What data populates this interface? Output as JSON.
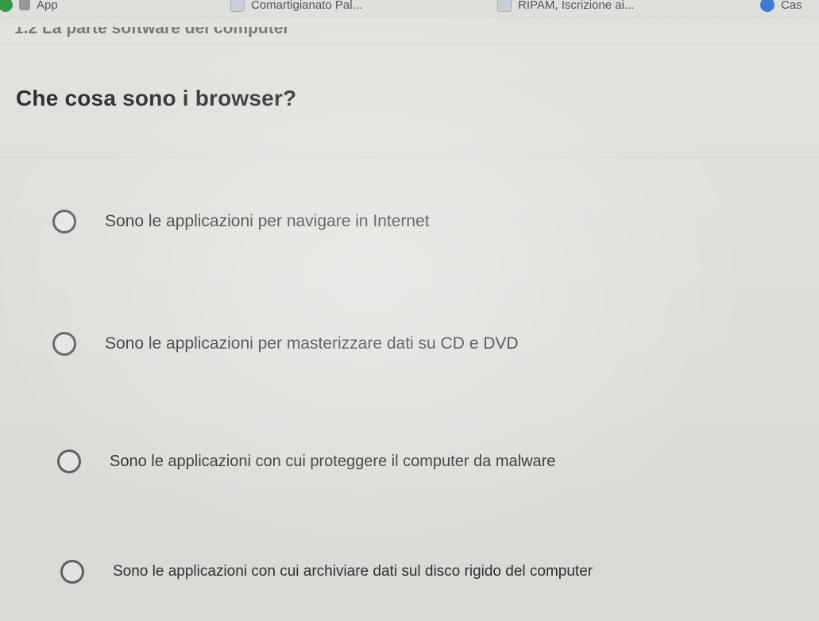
{
  "bookmarks": [
    {
      "label": "App",
      "icon": "app-grid-icon"
    },
    {
      "label": "Comartigianato Pal...",
      "icon": "page-icon"
    },
    {
      "label": "RIPAM, Iscrizione ai...",
      "icon": "document-icon"
    },
    {
      "label": "Cas",
      "icon": "blue-circle-icon"
    }
  ],
  "section": {
    "heading": "1.2 La parte software del computer"
  },
  "quiz": {
    "question": "Che cosa sono i browser?",
    "options": [
      {
        "label": "Sono le applicazioni per navigare in Internet"
      },
      {
        "label": "Sono le applicazioni per masterizzare dati su CD e DVD"
      },
      {
        "label": "Sono le applicazioni con cui proteggere il computer da malware"
      },
      {
        "label": "Sono le applicazioni con cui archiviare dati sul disco rigido del computer"
      }
    ]
  }
}
